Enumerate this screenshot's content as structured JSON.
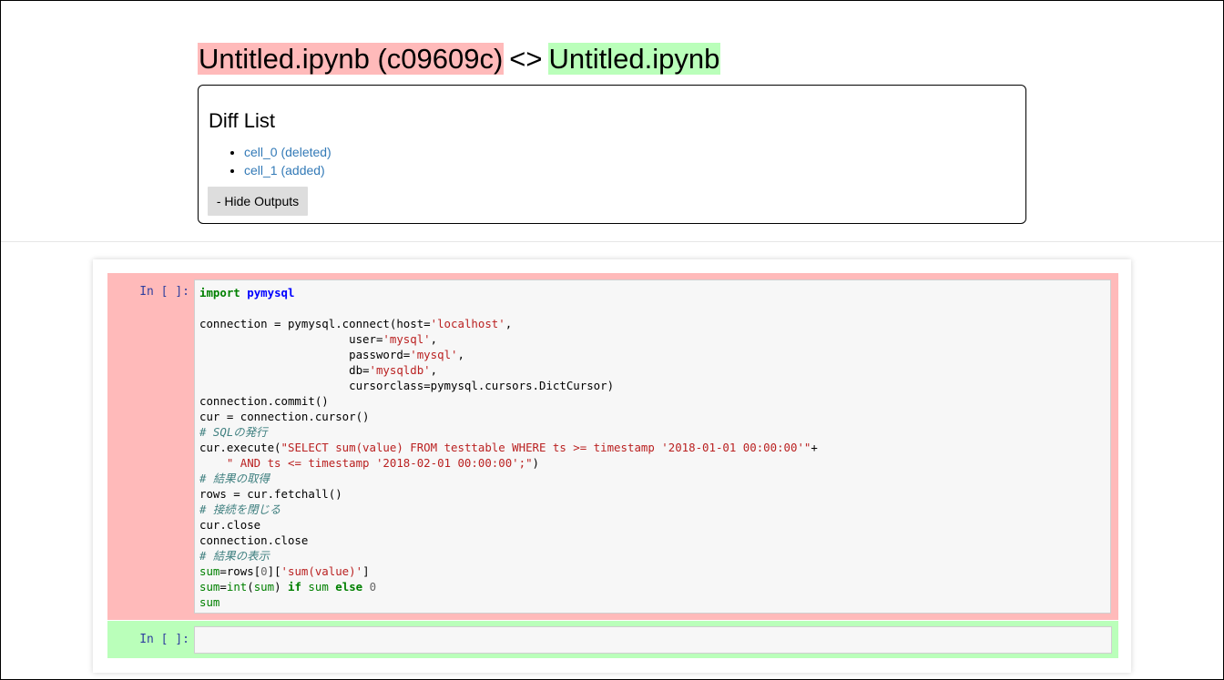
{
  "header": {
    "title_old": "Untitled.ipynb (c09609c)",
    "title_separator": "<>",
    "title_new": "Untitled.ipynb"
  },
  "diff_list": {
    "heading": "Diff List",
    "items": [
      {
        "label": "cell_0 (deleted)"
      },
      {
        "label": "cell_1 (added)"
      }
    ],
    "hide_outputs_label": "- Hide Outputs"
  },
  "cells": {
    "deleted": {
      "prompt": "In [ ]:",
      "code_lines": [
        "import pymysql",
        "",
        "connection = pymysql.connect(host='localhost',",
        "                      user='mysql',",
        "                      password='mysql',",
        "                      db='mysqldb',",
        "                      cursorclass=pymysql.cursors.DictCursor)",
        "connection.commit()",
        "cur = connection.cursor()",
        "# SQLの発行",
        "cur.execute(\"SELECT sum(value) FROM testtable WHERE ts >= timestamp '2018-01-01 00:00:00'\"+",
        "    \" AND ts <= timestamp '2018-02-01 00:00:00';\")",
        "# 結果の取得",
        "rows = cur.fetchall()",
        "# 接続を閉じる",
        "cur.close",
        "connection.close",
        "# 結果の表示",
        "sum=rows[0]['sum(value)']",
        "sum=int(sum) if sum else 0",
        "sum"
      ]
    },
    "added": {
      "prompt": "In [ ]:",
      "code_lines": []
    }
  },
  "colors": {
    "deleted_bg": "#ffbaba",
    "added_bg": "#baffba",
    "link": "#337ab7",
    "prompt": "#303f9f"
  }
}
